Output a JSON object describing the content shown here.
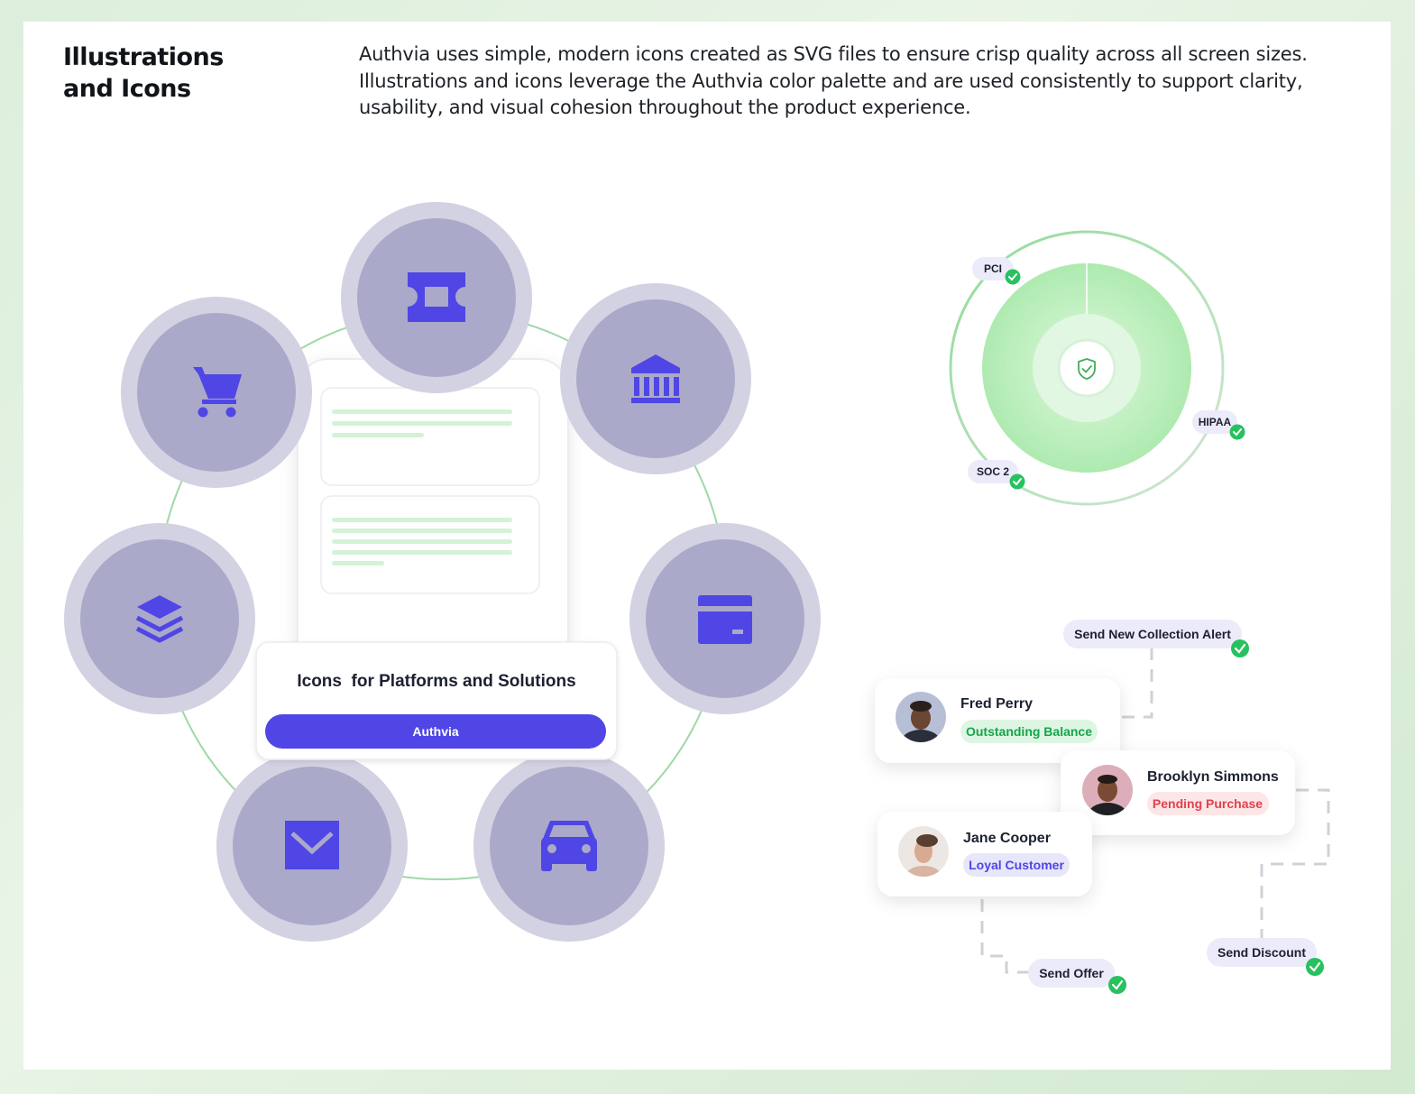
{
  "header": {
    "title_line1": "Illustrations",
    "title_line2": "and Icons",
    "description": "Authvia uses simple, modern icons created as SVG files to ensure crisp quality across all screen sizes. Illustrations and icons leverage the Authvia color palette and are used consistently to support clarity, usability, and visual cohesion throughout the product experience."
  },
  "colors": {
    "accent": "#4f46e5",
    "circle_inner": "#aaa9c9",
    "circle_outer": "#d3d2e2",
    "green": "#27c25f",
    "ring": "#9fd8a6"
  },
  "icon_wheel": {
    "icons": [
      "ticket-icon",
      "bank-icon",
      "credit-card-icon",
      "car-icon",
      "mail-icon",
      "layers-icon",
      "cart-icon"
    ],
    "panel_title": "Icons  for Platforms and Solutions",
    "panel_button": "Authvia"
  },
  "compliance": {
    "badges": [
      "PCI",
      "HIPAA",
      "SOC 2"
    ],
    "center_icon": "shield-check-icon"
  },
  "workflow": {
    "customers": [
      {
        "name": "Fred Perry",
        "tag": "Outstanding Balance",
        "tag_color": "#18a34a",
        "tag_bg": "#ddf6e3"
      },
      {
        "name": "Brooklyn Simmons",
        "tag": "Pending Purchase",
        "tag_color": "#e0424d",
        "tag_bg": "#fde6e7"
      },
      {
        "name": "Jane Cooper",
        "tag": "Loyal Customer",
        "tag_color": "#4f46e5",
        "tag_bg": "#e7e6fb"
      }
    ],
    "actions": {
      "collection": "Send New Collection Alert",
      "offer": "Send Offer",
      "discount": "Send Discount"
    }
  }
}
